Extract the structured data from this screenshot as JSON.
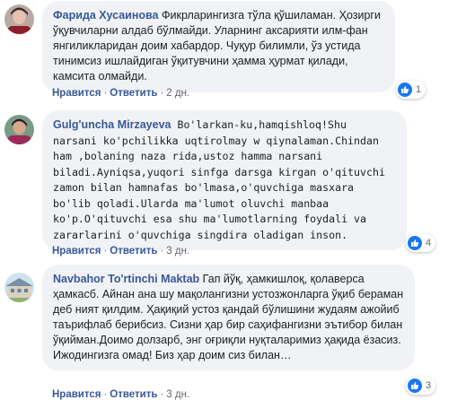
{
  "comments": [
    {
      "author": "Фарида Хусаинова",
      "text": "Фикрларингизга тўла қўшиламан. Ҳозирги ўқувчиларни алдаб бўлмайди. Уларнинг аксарияти илм-фан янгиликларидан доим хабардор. Чуқур билимли, ўз устида тинимсиз ишлайдиган ўқитувчини ҳамма ҳурмат қилади, камсита олмайди.",
      "like_label": "Нравится",
      "reply_label": "Ответить",
      "time": "2 дн.",
      "reactions": "1"
    },
    {
      "author": "Gulg'uncha Mirzayeva",
      "text": "Bo'larkan-ku,hamqishloq!Shu narsani ko'pchilikka uqtirolmay w qiynalaman.Chindan ham ,bolaning naza rida,ustoz hamma narsani biladi.Ayniqsa,yuqori sinfga darsga kirgan o'qituvchi zamon bilan hamnafas bo'lmasa,o'quvchiga masxara bo'lib qoladi.Ularda ma'lumot oluvchi manbaa ko'p.O'qituvchi esa shu ma'lumotlarning foydali va zararlarini o'quvchiga singdira oladigan inson.",
      "like_label": "Нравится",
      "reply_label": "Ответить",
      "time": "3 дн.",
      "reactions": "4"
    },
    {
      "author": "Navbahor To'rtinchi Maktab",
      "text": "Гап йўқ, ҳамкишлоқ, қолаверса ҳамкасб. Айнан ана шу мақолангизни устозжонларга ўқиб бераман деб ният қилдим. Ҳақиқий устоз қандай бўлишини жудаям ажойиб таърифлаб берибсиз. Сизни ҳар бир саҳифангизни эътибор билан ўқийман.Доимо долзарб, энг оғриқли нуқталаримиз ҳақида ёзасиз. Ижодингизга омад! Биз ҳар доим сиз билан…",
      "like_label": "Нравится",
      "reply_label": "Ответить",
      "time": "3 дн.",
      "reactions": "3"
    }
  ],
  "colors": {
    "link": "#385898",
    "bubble": "#f0f2f5",
    "like": "#1877f2"
  }
}
